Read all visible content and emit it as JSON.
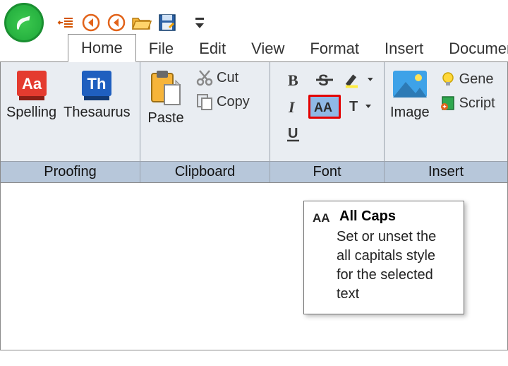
{
  "qat": {
    "items": [
      "indent-icon",
      "back-icon",
      "back-icon-2",
      "open-folder-icon",
      "save-icon",
      "customize-icon"
    ]
  },
  "tabs": {
    "items": [
      {
        "label": "Home",
        "active": true
      },
      {
        "label": "File"
      },
      {
        "label": "Edit"
      },
      {
        "label": "View"
      },
      {
        "label": "Format"
      },
      {
        "label": "Insert"
      },
      {
        "label": "Document"
      }
    ]
  },
  "ribbon": {
    "proofing": {
      "label": "Proofing",
      "spelling": "Spelling",
      "thesaurus": "Thesaurus"
    },
    "clipboard": {
      "label": "Clipboard",
      "paste": "Paste",
      "cut": "Cut",
      "copy": "Copy"
    },
    "font": {
      "label": "Font"
    },
    "insert": {
      "label": "Insert",
      "image": "Image",
      "generate": "Gene",
      "script": "Script"
    }
  },
  "tooltip": {
    "title": "All Caps",
    "desc": "Set or unset the all capitals style for the selected text"
  }
}
